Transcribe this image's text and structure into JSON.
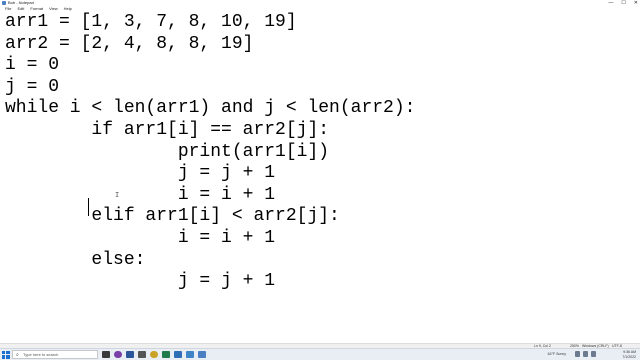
{
  "window": {
    "title": "Bob - Notepad",
    "controls": {
      "minimize": "—",
      "maximize": "☐",
      "close": "✕"
    }
  },
  "menu": [
    "File",
    "Edit",
    "Format",
    "View",
    "Help"
  ],
  "editor": {
    "lines": [
      "arr1 = [1, 3, 7, 8, 10, 19]",
      "arr2 = [2, 4, 8, 8, 19]",
      "i = 0",
      "j = 0",
      "while i < len(arr1) and j < len(arr2):",
      "        if arr1[i] == arr2[j]:",
      "                print(arr1[i])",
      "                j = j + 1",
      "                i = i + 1",
      "        elif arr1[i] < arr2[j]:",
      "                i = i + 1",
      "        else:",
      "                j = j + 1"
    ]
  },
  "status": {
    "position": "Ln 9, Col 2",
    "zoom": "250%",
    "line_ending": "Windows (CRLF)",
    "encoding": "UTF-8"
  },
  "taskbar": {
    "search_placeholder": "Type here to search",
    "weather": "64°F Sunny",
    "time": "9:36 AM",
    "date": "7/1/2022"
  },
  "colors": {
    "taskbar_bg": "#e9eef5",
    "start_blue": "#1a6fd1"
  }
}
